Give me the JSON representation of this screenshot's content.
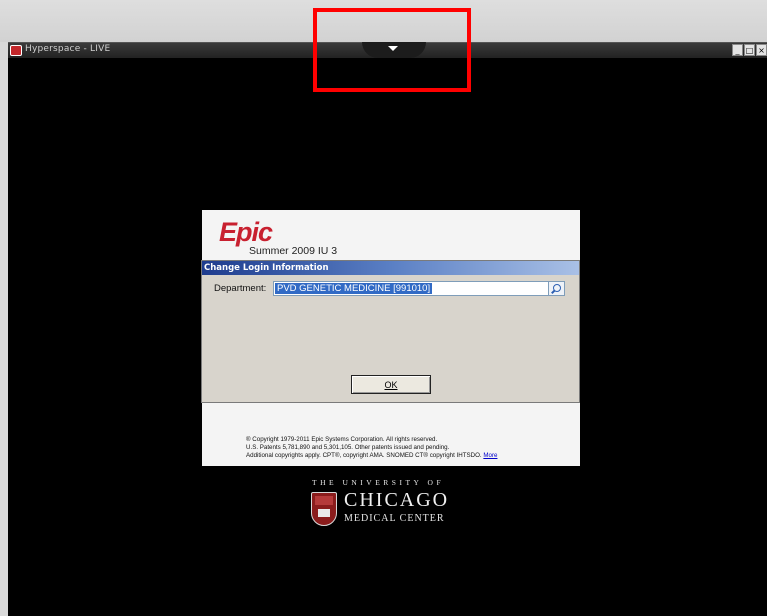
{
  "window": {
    "title": "Hyperspace - LIVE",
    "controls": [
      "_",
      "□",
      "×"
    ]
  },
  "splash": {
    "brand": "Epic",
    "version": "Summer 2009 IU 3",
    "copyright_line1": "® Copyright 1979-2011 Epic Systems Corporation. All rights reserved.",
    "copyright_line2": "U.S. Patents 5,781,890 and 5,301,105. Other patents issued and pending.",
    "copyright_line3": "Additional copyrights apply. CPT®, copyright AMA. SNOMED CT® copyright IHTSDO.",
    "more_link": "More"
  },
  "dialog": {
    "title": "Change Login Information",
    "department_label": "Department:",
    "department_value": "PVD GENETIC MEDICINE [991010]",
    "ok_label": "OK"
  },
  "institution": {
    "line1": "THE UNIVERSITY OF",
    "line2": "CHICAGO",
    "line3": "MEDICAL CENTER"
  },
  "colors": {
    "epic_red": "#c8202f",
    "highlight_box": "#ff0000",
    "selection": "#316ac5"
  },
  "icons": {
    "app": "hyperspace-app-icon",
    "pull_tab": "chevron-down-icon",
    "search": "search-icon",
    "crest": "university-crest"
  }
}
